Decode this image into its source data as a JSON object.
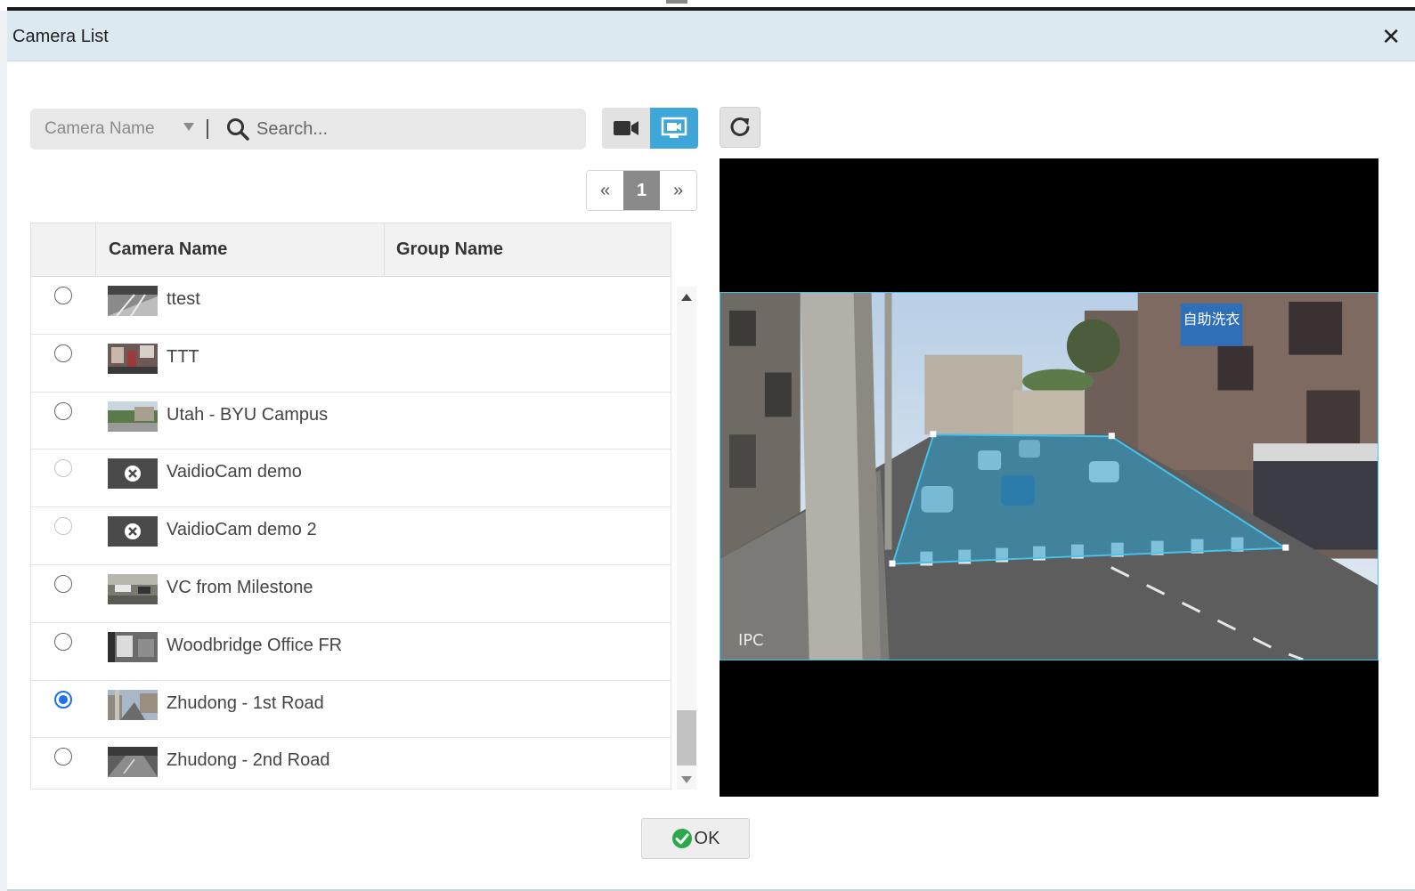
{
  "dialog": {
    "title": "Camera List"
  },
  "filter": {
    "field_selected": "Camera Name",
    "search_placeholder": "Search..."
  },
  "pager": {
    "prev": "«",
    "current": "1",
    "next": "»"
  },
  "table": {
    "headers": [
      "Camera Name",
      "Group Name"
    ],
    "rows": [
      {
        "name": "ttest",
        "group": "",
        "selected": false,
        "disabled": false,
        "thumb": "image"
      },
      {
        "name": "TTT",
        "group": "",
        "selected": false,
        "disabled": false,
        "thumb": "image"
      },
      {
        "name": "Utah - BYU Campus",
        "group": "",
        "selected": false,
        "disabled": false,
        "thumb": "image"
      },
      {
        "name": "VaidioCam demo",
        "group": "",
        "selected": false,
        "disabled": true,
        "thumb": "error-icon"
      },
      {
        "name": "VaidioCam demo 2",
        "group": "",
        "selected": false,
        "disabled": true,
        "thumb": "error-icon"
      },
      {
        "name": "VC from Milestone",
        "group": "",
        "selected": false,
        "disabled": false,
        "thumb": "image"
      },
      {
        "name": "Woodbridge Office FR",
        "group": "",
        "selected": false,
        "disabled": false,
        "thumb": "image"
      },
      {
        "name": "Zhudong - 1st Road",
        "group": "",
        "selected": true,
        "disabled": false,
        "thumb": "image"
      },
      {
        "name": "Zhudong - 2nd Road",
        "group": "",
        "selected": false,
        "disabled": false,
        "thumb": "image"
      }
    ]
  },
  "preview": {
    "watermark": "IPC",
    "sign_text": "自助洗衣"
  },
  "footer": {
    "ok_label": "OK"
  },
  "colors": {
    "accent": "#3fa6d9",
    "selected_radio": "#1a73e8",
    "roi": "#48c1e8",
    "ok_check": "#2aa84a"
  }
}
